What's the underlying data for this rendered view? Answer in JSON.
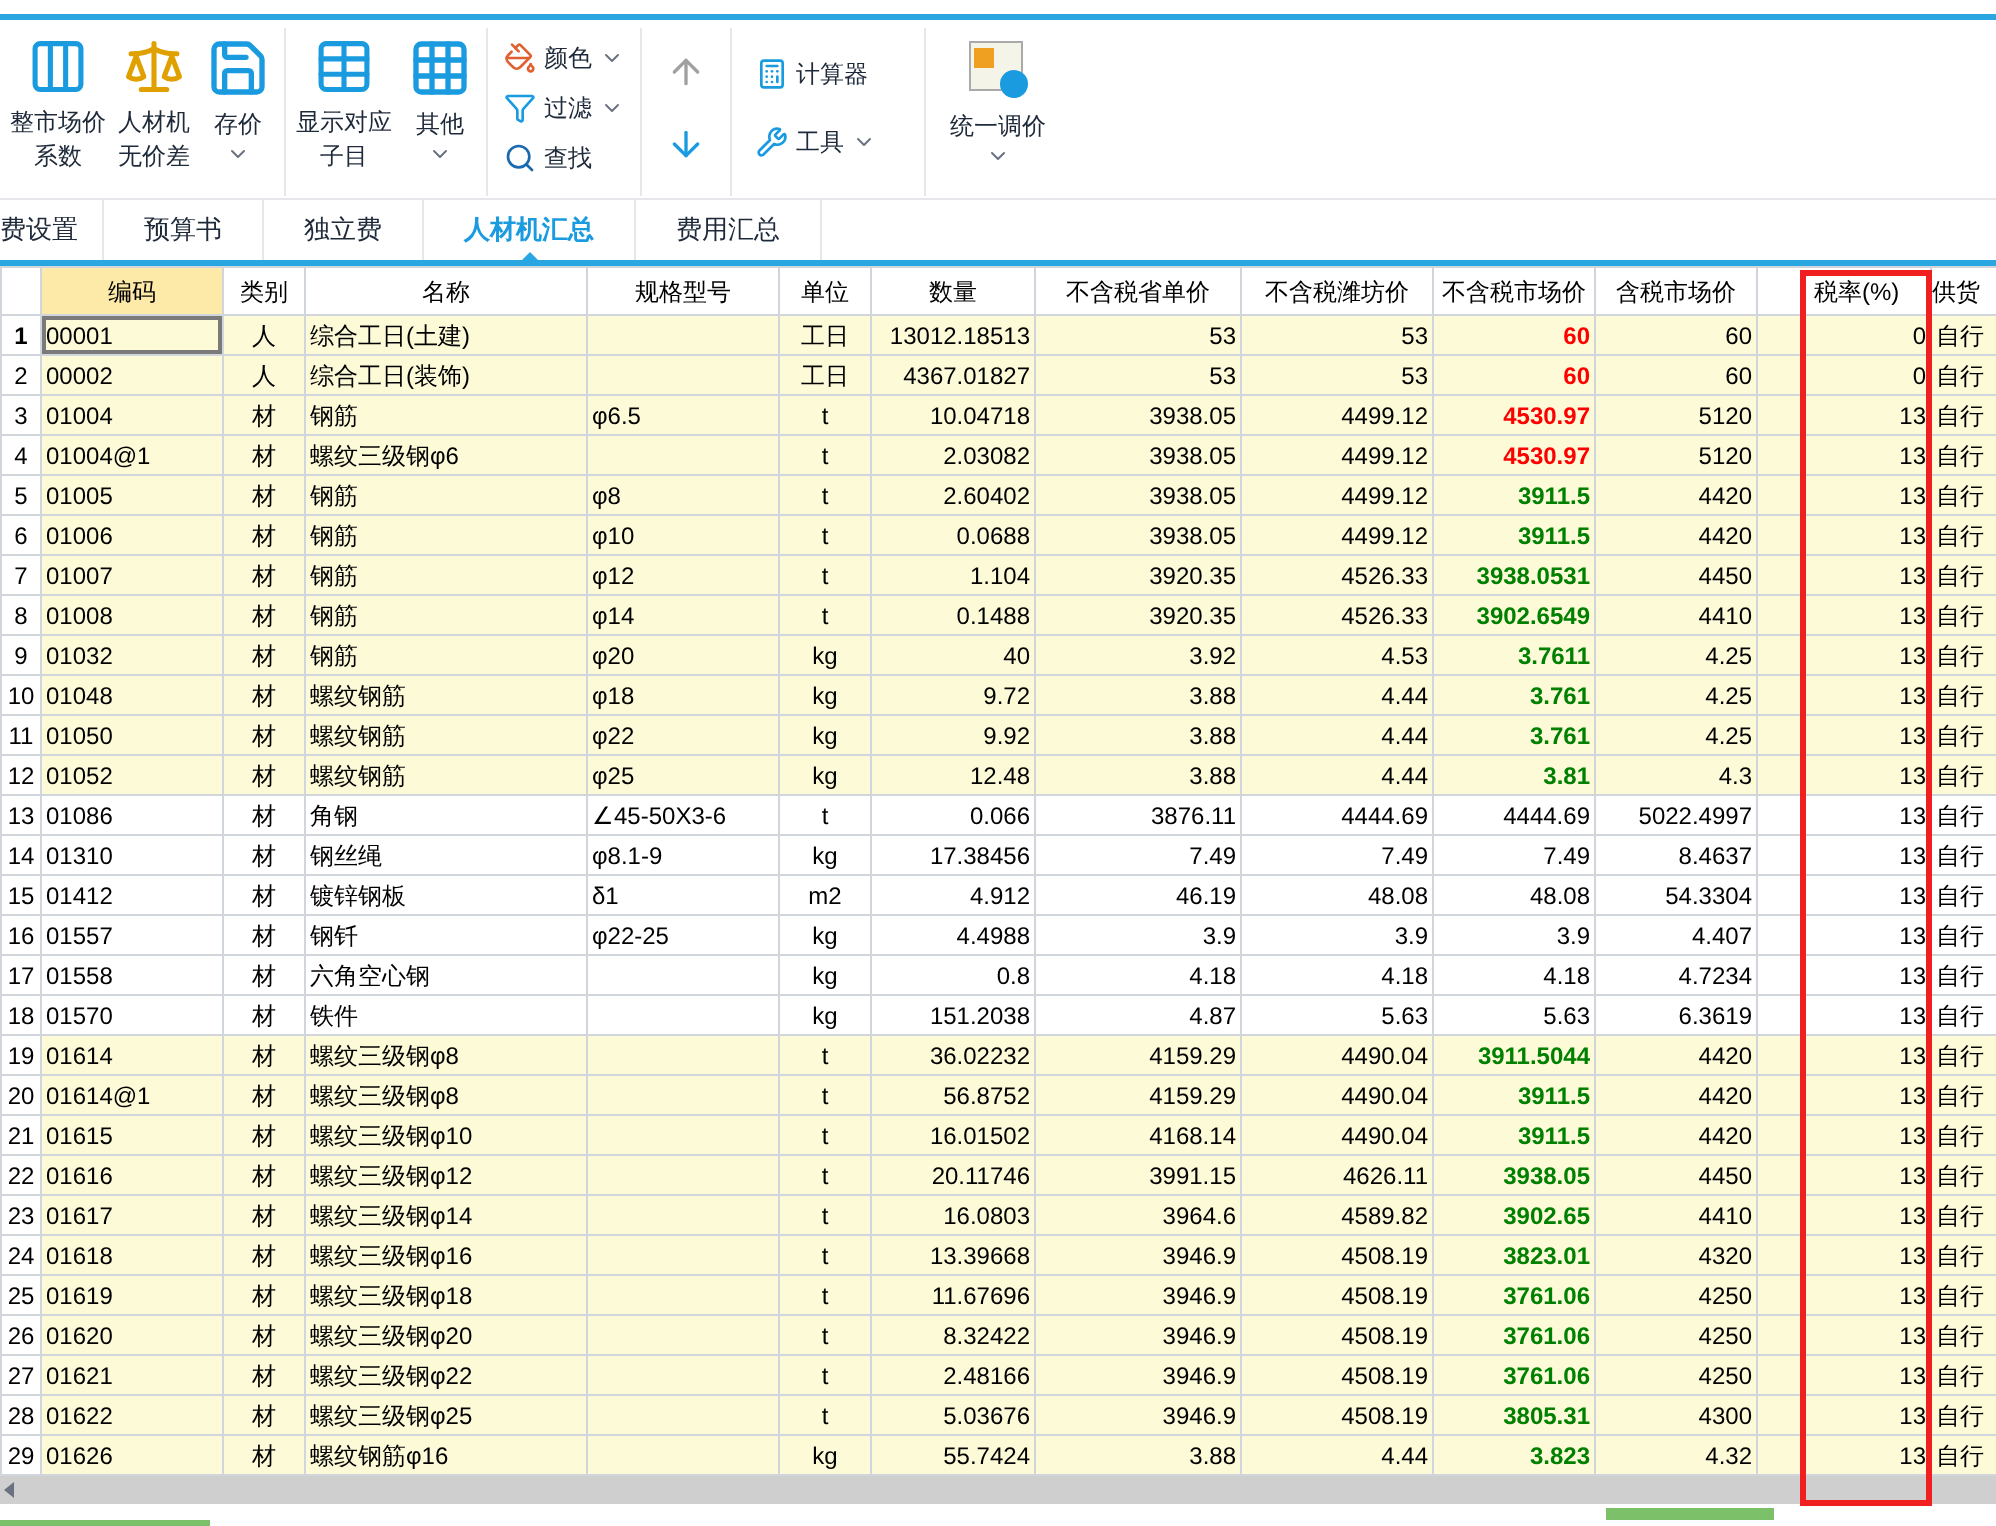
{
  "ribbon": {
    "groups": [
      {
        "buttons": [
          {
            "label": "整市场价系数",
            "menu": false
          },
          {
            "label": "人材机无价差",
            "menu": false
          },
          {
            "label": "存价",
            "menu": true
          }
        ]
      },
      {
        "buttons": [
          {
            "label": "显示对应子目",
            "menu": false
          },
          {
            "label": "其他",
            "menu": true
          }
        ]
      }
    ],
    "small_tools": [
      {
        "label": "颜色",
        "menu": true
      },
      {
        "label": "过滤",
        "menu": true
      },
      {
        "label": "查找",
        "menu": false
      }
    ],
    "move_buttons": [
      {
        "disabled": true
      },
      {
        "disabled": false
      }
    ],
    "tools": [
      {
        "label": "计算器",
        "menu": false
      },
      {
        "label": "工具",
        "menu": true
      }
    ],
    "big_button": {
      "label": "统一调价",
      "menu": true
    }
  },
  "tabs": [
    {
      "label": "费设置",
      "selected": false
    },
    {
      "label": "预算书",
      "selected": false
    },
    {
      "label": "独立费",
      "selected": false
    },
    {
      "label": "人材机汇总",
      "selected": true
    },
    {
      "label": "费用汇总",
      "selected": false
    }
  ],
  "table": {
    "columns": [
      "编码",
      "类别",
      "名称",
      "规格型号",
      "单位",
      "数量",
      "不含税省单价",
      "不含税潍坊价",
      "不含税市场价",
      "含税市场价",
      "税率(%)",
      "供货"
    ],
    "rows": [
      {
        "no": "1",
        "selected": true,
        "highlighted": true,
        "cells": [
          "00001",
          "人",
          "综合工日(土建)",
          "",
          "工日",
          "13012.18513",
          "53",
          "53",
          "60",
          "60",
          "0",
          "自行"
        ],
        "color": "#ff0000"
      },
      {
        "no": "2",
        "selected": false,
        "highlighted": true,
        "cells": [
          "00002",
          "人",
          "综合工日(装饰)",
          "",
          "工日",
          "4367.01827",
          "53",
          "53",
          "60",
          "60",
          "0",
          "自行"
        ],
        "color": "#ff0000"
      },
      {
        "no": "3",
        "selected": false,
        "highlighted": true,
        "cells": [
          "01004",
          "材",
          "钢筋",
          "φ6.5",
          "t",
          "10.04718",
          "3938.05",
          "4499.12",
          "4530.97",
          "5120",
          "13",
          "自行"
        ],
        "color": "#ff0000"
      },
      {
        "no": "4",
        "selected": false,
        "highlighted": true,
        "cells": [
          "01004@1",
          "材",
          "螺纹三级钢φ6",
          "",
          "t",
          "2.03082",
          "3938.05",
          "4499.12",
          "4530.97",
          "5120",
          "13",
          "自行"
        ],
        "color": "#ff0000"
      },
      {
        "no": "5",
        "selected": false,
        "highlighted": true,
        "cells": [
          "01005",
          "材",
          "钢筋",
          "φ8",
          "t",
          "2.60402",
          "3938.05",
          "4499.12",
          "3911.5",
          "4420",
          "13",
          "自行"
        ],
        "color": "#008000"
      },
      {
        "no": "6",
        "selected": false,
        "highlighted": true,
        "cells": [
          "01006",
          "材",
          "钢筋",
          "φ10",
          "t",
          "0.0688",
          "3938.05",
          "4499.12",
          "3911.5",
          "4420",
          "13",
          "自行"
        ],
        "color": "#008000"
      },
      {
        "no": "7",
        "selected": false,
        "highlighted": true,
        "cells": [
          "01007",
          "材",
          "钢筋",
          "φ12",
          "t",
          "1.104",
          "3920.35",
          "4526.33",
          "3938.0531",
          "4450",
          "13",
          "自行"
        ],
        "color": "#008000"
      },
      {
        "no": "8",
        "selected": false,
        "highlighted": true,
        "cells": [
          "01008",
          "材",
          "钢筋",
          "φ14",
          "t",
          "0.1488",
          "3920.35",
          "4526.33",
          "3902.6549",
          "4410",
          "13",
          "自行"
        ],
        "color": "#008000"
      },
      {
        "no": "9",
        "selected": false,
        "highlighted": true,
        "cells": [
          "01032",
          "材",
          "钢筋",
          "φ20",
          "kg",
          "40",
          "3.92",
          "4.53",
          "3.7611",
          "4.25",
          "13",
          "自行"
        ],
        "color": "#008000"
      },
      {
        "no": "10",
        "selected": false,
        "highlighted": true,
        "cells": [
          "01048",
          "材",
          "螺纹钢筋",
          "φ18",
          "kg",
          "9.72",
          "3.88",
          "4.44",
          "3.761",
          "4.25",
          "13",
          "自行"
        ],
        "color": "#008000"
      },
      {
        "no": "11",
        "selected": false,
        "highlighted": true,
        "cells": [
          "01050",
          "材",
          "螺纹钢筋",
          "φ22",
          "kg",
          "9.92",
          "3.88",
          "4.44",
          "3.761",
          "4.25",
          "13",
          "自行"
        ],
        "color": "#008000"
      },
      {
        "no": "12",
        "selected": false,
        "highlighted": true,
        "cells": [
          "01052",
          "材",
          "螺纹钢筋",
          "φ25",
          "kg",
          "12.48",
          "3.88",
          "4.44",
          "3.81",
          "4.3",
          "13",
          "自行"
        ],
        "color": "#008000"
      },
      {
        "no": "13",
        "selected": false,
        "highlighted": false,
        "cells": [
          "01086",
          "材",
          "角钢",
          "∠45-50X3-6",
          "t",
          "0.066",
          "3876.11",
          "4444.69",
          "4444.69",
          "5022.4997",
          "13",
          "自行"
        ],
        "color": "#000000"
      },
      {
        "no": "14",
        "selected": false,
        "highlighted": false,
        "cells": [
          "01310",
          "材",
          "钢丝绳",
          "φ8.1-9",
          "kg",
          "17.38456",
          "7.49",
          "7.49",
          "7.49",
          "8.4637",
          "13",
          "自行"
        ],
        "color": "#000000"
      },
      {
        "no": "15",
        "selected": false,
        "highlighted": false,
        "cells": [
          "01412",
          "材",
          "镀锌钢板",
          "δ1",
          "m2",
          "4.912",
          "46.19",
          "48.08",
          "48.08",
          "54.3304",
          "13",
          "自行"
        ],
        "color": "#000000"
      },
      {
        "no": "16",
        "selected": false,
        "highlighted": false,
        "cells": [
          "01557",
          "材",
          "钢钎",
          "φ22-25",
          "kg",
          "4.4988",
          "3.9",
          "3.9",
          "3.9",
          "4.407",
          "13",
          "自行"
        ],
        "color": "#000000"
      },
      {
        "no": "17",
        "selected": false,
        "highlighted": false,
        "cells": [
          "01558",
          "材",
          "六角空心钢",
          "",
          "kg",
          "0.8",
          "4.18",
          "4.18",
          "4.18",
          "4.7234",
          "13",
          "自行"
        ],
        "color": "#000000"
      },
      {
        "no": "18",
        "selected": false,
        "highlighted": false,
        "cells": [
          "01570",
          "材",
          "铁件",
          "",
          "kg",
          "151.2038",
          "4.87",
          "5.63",
          "5.63",
          "6.3619",
          "13",
          "自行"
        ],
        "color": "#000000"
      },
      {
        "no": "19",
        "selected": false,
        "highlighted": true,
        "cells": [
          "01614",
          "材",
          "螺纹三级钢φ8",
          "",
          "t",
          "36.02232",
          "4159.29",
          "4490.04",
          "3911.5044",
          "4420",
          "13",
          "自行"
        ],
        "color": "#008000"
      },
      {
        "no": "20",
        "selected": false,
        "highlighted": true,
        "cells": [
          "01614@1",
          "材",
          "螺纹三级钢φ8",
          "",
          "t",
          "56.8752",
          "4159.29",
          "4490.04",
          "3911.5",
          "4420",
          "13",
          "自行"
        ],
        "color": "#008000"
      },
      {
        "no": "21",
        "selected": false,
        "highlighted": true,
        "cells": [
          "01615",
          "材",
          "螺纹三级钢φ10",
          "",
          "t",
          "16.01502",
          "4168.14",
          "4490.04",
          "3911.5",
          "4420",
          "13",
          "自行"
        ],
        "color": "#008000"
      },
      {
        "no": "22",
        "selected": false,
        "highlighted": true,
        "cells": [
          "01616",
          "材",
          "螺纹三级钢φ12",
          "",
          "t",
          "20.11746",
          "3991.15",
          "4626.11",
          "3938.05",
          "4450",
          "13",
          "自行"
        ],
        "color": "#008000"
      },
      {
        "no": "23",
        "selected": false,
        "highlighted": true,
        "cells": [
          "01617",
          "材",
          "螺纹三级钢φ14",
          "",
          "t",
          "16.0803",
          "3964.6",
          "4589.82",
          "3902.65",
          "4410",
          "13",
          "自行"
        ],
        "color": "#008000"
      },
      {
        "no": "24",
        "selected": false,
        "highlighted": true,
        "cells": [
          "01618",
          "材",
          "螺纹三级钢φ16",
          "",
          "t",
          "13.39668",
          "3946.9",
          "4508.19",
          "3823.01",
          "4320",
          "13",
          "自行"
        ],
        "color": "#008000"
      },
      {
        "no": "25",
        "selected": false,
        "highlighted": true,
        "cells": [
          "01619",
          "材",
          "螺纹三级钢φ18",
          "",
          "t",
          "11.67696",
          "3946.9",
          "4508.19",
          "3761.06",
          "4250",
          "13",
          "自行"
        ],
        "color": "#008000"
      },
      {
        "no": "26",
        "selected": false,
        "highlighted": true,
        "cells": [
          "01620",
          "材",
          "螺纹三级钢φ20",
          "",
          "t",
          "8.32422",
          "3946.9",
          "4508.19",
          "3761.06",
          "4250",
          "13",
          "自行"
        ],
        "color": "#008000"
      },
      {
        "no": "27",
        "selected": false,
        "highlighted": true,
        "cells": [
          "01621",
          "材",
          "螺纹三级钢φ22",
          "",
          "t",
          "2.48166",
          "3946.9",
          "4508.19",
          "3761.06",
          "4250",
          "13",
          "自行"
        ],
        "color": "#008000"
      },
      {
        "no": "28",
        "selected": false,
        "highlighted": true,
        "cells": [
          "01622",
          "材",
          "螺纹三级钢φ25",
          "",
          "t",
          "5.03676",
          "3946.9",
          "4508.19",
          "3805.31",
          "4300",
          "13",
          "自行"
        ],
        "color": "#008000"
      },
      {
        "no": "29",
        "selected": false,
        "highlighted": true,
        "cells": [
          "01626",
          "材",
          "螺纹钢筋φ16",
          "",
          "kg",
          "55.7424",
          "3.88",
          "4.44",
          "3.823",
          "4.32",
          "13",
          "自行"
        ],
        "color": "#008000"
      }
    ]
  }
}
